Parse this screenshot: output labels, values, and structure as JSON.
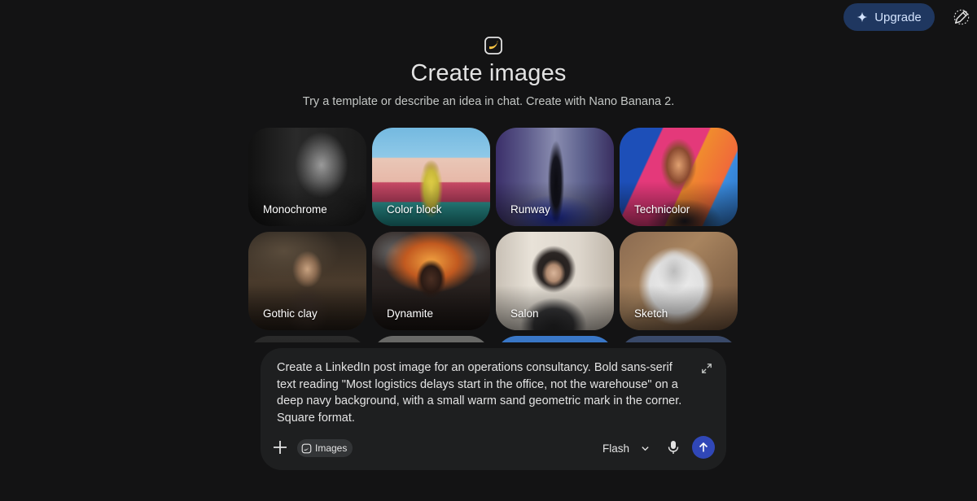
{
  "topbar": {
    "upgrade_label": "Upgrade",
    "upgrade_icon": "sparkle-icon",
    "new_chat_icon": "edit-icon"
  },
  "header": {
    "icon": "banana-image-icon",
    "title": "Create images",
    "subtitle": "Try a template or describe an idea in chat. Create with Nano Banana 2."
  },
  "templates": [
    {
      "label": "Monochrome"
    },
    {
      "label": "Color block"
    },
    {
      "label": "Runway"
    },
    {
      "label": "Technicolor"
    },
    {
      "label": "Gothic clay"
    },
    {
      "label": "Dynamite"
    },
    {
      "label": "Salon"
    },
    {
      "label": "Sketch"
    }
  ],
  "composer": {
    "prompt": "Create a LinkedIn post image for an operations consultancy. Bold sans-serif text reading \"Most logistics delays start in the office, not the warehouse\" on a deep navy background, with a small warm sand geometric mark in the corner. Square format.",
    "tool_chip_label": "Images",
    "model_label": "Flash",
    "icons": [
      "expand-icon",
      "plus-icon",
      "images-icon",
      "chevron-down-icon",
      "mic-icon",
      "send-arrow-icon"
    ]
  },
  "colors": {
    "background": "#131314",
    "composer": "#1e1f20",
    "upgrade_button": "#1f3760",
    "send_button": "#3047b7"
  }
}
